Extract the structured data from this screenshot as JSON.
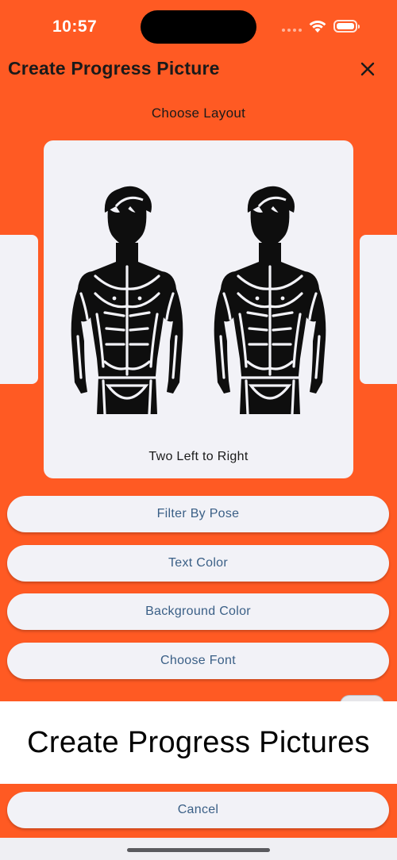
{
  "status_bar": {
    "time": "10:57"
  },
  "header": {
    "title": "Create Progress Picture",
    "close_icon": "close-icon"
  },
  "layout_picker": {
    "heading": "Choose Layout",
    "selected_layout": "Two Left to Right"
  },
  "buttons": {
    "filter_by_pose": "Filter By Pose",
    "text_color": "Text Color",
    "background_color": "Background Color",
    "choose_font": "Choose Font",
    "cancel": "Cancel"
  },
  "banner": {
    "text": "Create Progress Pictures"
  },
  "colors": {
    "background": "#FF5A23",
    "card": "#F2F2F7",
    "button_text": "#3A5F86"
  }
}
